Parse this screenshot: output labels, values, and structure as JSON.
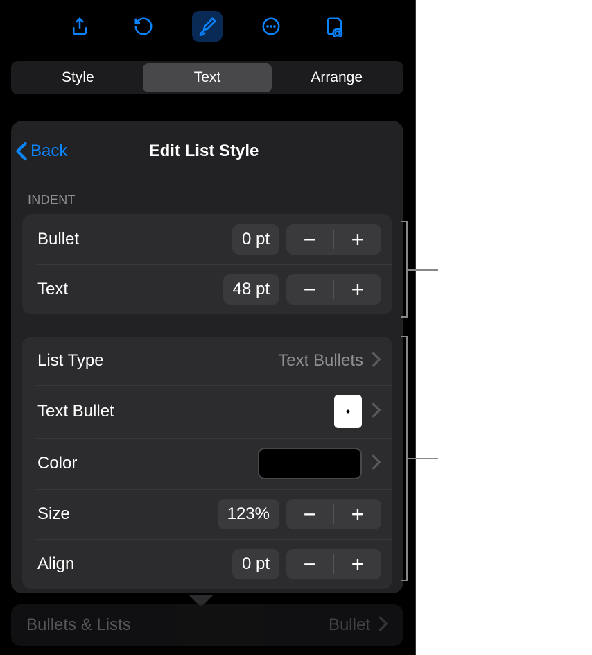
{
  "toolbar": {
    "icons": [
      "share",
      "undo",
      "format",
      "more",
      "document-settings"
    ]
  },
  "tabs": {
    "style": "Style",
    "text": "Text",
    "arrange": "Arrange"
  },
  "header": {
    "back": "Back",
    "title": "Edit List Style"
  },
  "sections": {
    "indent": "INDENT"
  },
  "indent": {
    "bullet_label": "Bullet",
    "bullet_value": "0 pt",
    "text_label": "Text",
    "text_value": "48 pt"
  },
  "style": {
    "list_type_label": "List Type",
    "list_type_value": "Text Bullets",
    "text_bullet_label": "Text Bullet",
    "text_bullet_glyph": "•",
    "color_label": "Color",
    "size_label": "Size",
    "size_value": "123%",
    "align_label": "Align",
    "align_value": "0 pt"
  },
  "footer": {
    "bullets_lists": "Bullets & Lists",
    "bullets_lists_value": "Bullet"
  },
  "stepper": {
    "minus": "−",
    "plus": "+"
  }
}
